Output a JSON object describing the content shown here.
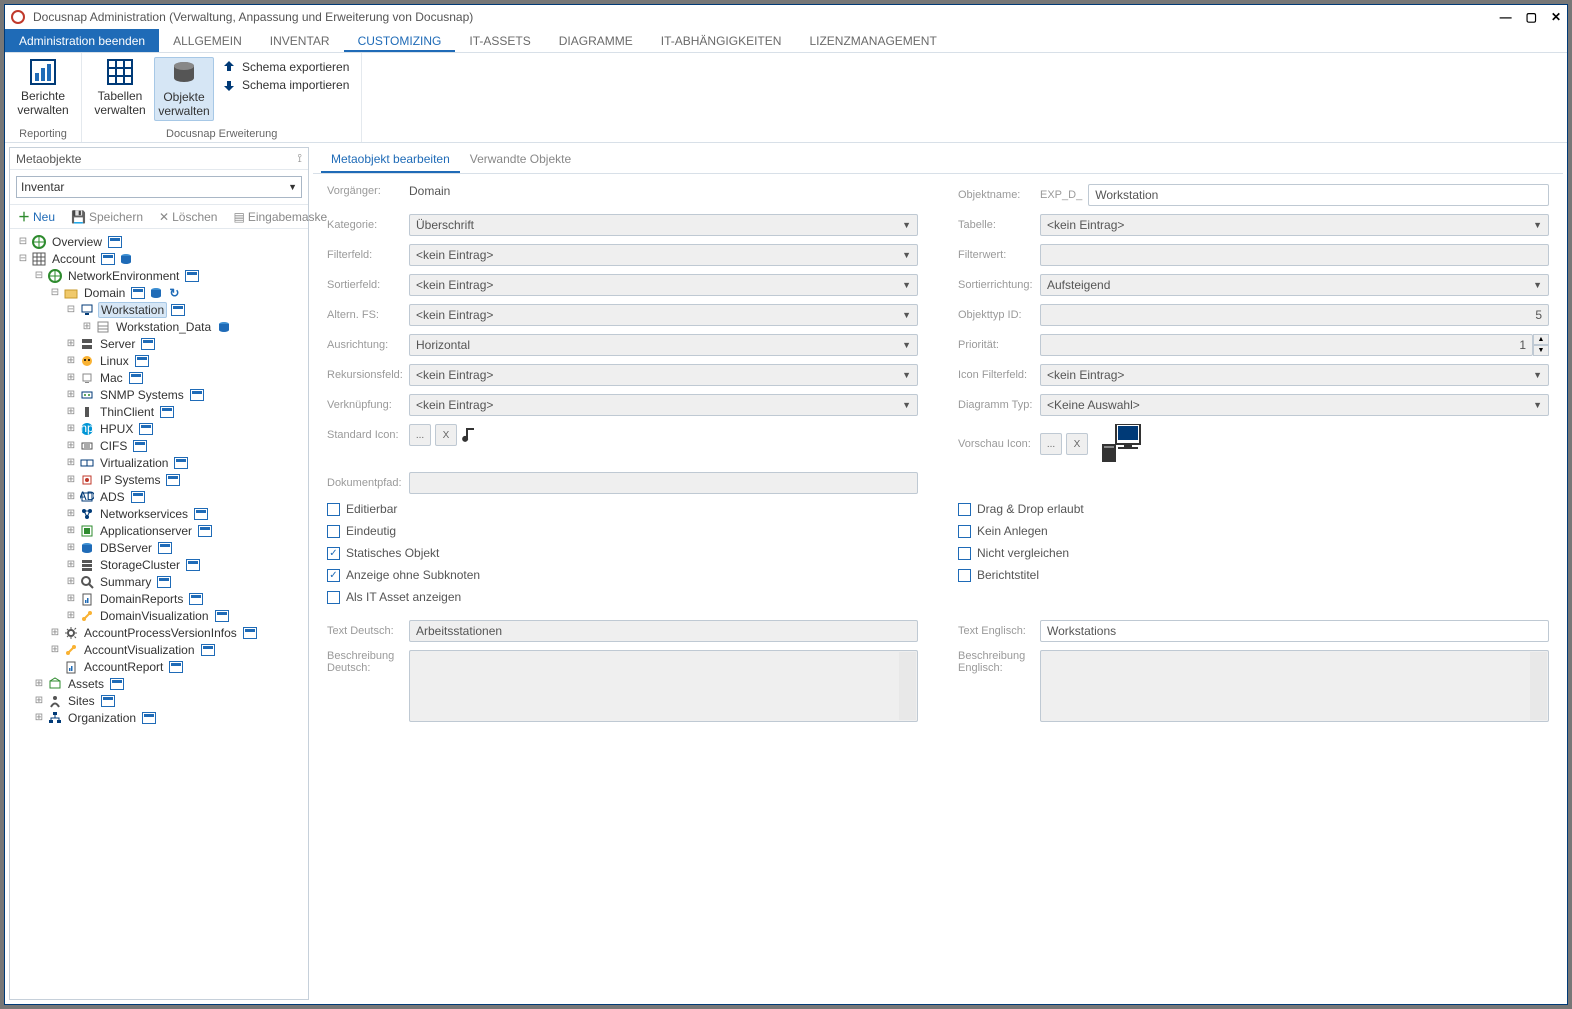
{
  "window": {
    "title": "Docusnap Administration (Verwaltung, Anpassung und Erweiterung von Docusnap)"
  },
  "menu": {
    "primary": "Administration beenden",
    "items": [
      "ALLGEMEIN",
      "INVENTAR",
      "CUSTOMIZING",
      "IT-ASSETS",
      "DIAGRAMME",
      "IT-ABHÄNGIGKEITEN",
      "LIZENZMANAGEMENT"
    ],
    "active_index": 2
  },
  "ribbon": {
    "berichte": "Berichte\nverwalten",
    "tabellen": "Tabellen\nverwalten",
    "objekte": "Objekte\nverwalten",
    "schema_export": "Schema exportieren",
    "schema_import": "Schema importieren",
    "group_reporting": "Reporting",
    "group_ext": "Docusnap Erweiterung"
  },
  "sidebar": {
    "title": "Metaobjekte",
    "selector_value": "Inventar",
    "toolbar": {
      "neu": "Neu",
      "speichern": "Speichern",
      "loeschen": "Löschen",
      "eingabemaske": "Eingabemaske"
    },
    "tree": [
      {
        "d": 0,
        "tw": "-",
        "ico": "globe",
        "txt": "Overview",
        "b": true
      },
      {
        "d": 0,
        "tw": "-",
        "ico": "grid",
        "txt": "Account",
        "b": true,
        "extra": "db"
      },
      {
        "d": 1,
        "tw": "-",
        "ico": "globe",
        "txt": "NetworkEnvironment",
        "b": true
      },
      {
        "d": 2,
        "tw": "-",
        "ico": "folder",
        "txt": "Domain",
        "b": true,
        "extra": "db",
        "refresh": true
      },
      {
        "d": 3,
        "tw": "-",
        "ico": "pc",
        "txt": "Workstation",
        "b": true,
        "sel": true
      },
      {
        "d": 4,
        "tw": "+",
        "ico": "data",
        "txt": "Workstation_Data",
        "b": false,
        "extra": "db"
      },
      {
        "d": 3,
        "tw": "+",
        "ico": "server",
        "txt": "Server",
        "b": true
      },
      {
        "d": 3,
        "tw": "+",
        "ico": "linux",
        "txt": "Linux",
        "b": true
      },
      {
        "d": 3,
        "tw": "+",
        "ico": "mac",
        "txt": "Mac",
        "b": true
      },
      {
        "d": 3,
        "tw": "+",
        "ico": "snmp",
        "txt": "SNMP Systems",
        "b": true
      },
      {
        "d": 3,
        "tw": "+",
        "ico": "thin",
        "txt": "ThinClient",
        "b": true
      },
      {
        "d": 3,
        "tw": "+",
        "ico": "hp",
        "txt": "HPUX",
        "b": true
      },
      {
        "d": 3,
        "tw": "+",
        "ico": "cifs",
        "txt": "CIFS",
        "b": true
      },
      {
        "d": 3,
        "tw": "+",
        "ico": "virt",
        "txt": "Virtualization",
        "b": true
      },
      {
        "d": 3,
        "tw": "+",
        "ico": "ip",
        "txt": "IP Systems",
        "b": true
      },
      {
        "d": 3,
        "tw": "+",
        "ico": "ads",
        "txt": "ADS",
        "b": true
      },
      {
        "d": 3,
        "tw": "+",
        "ico": "net",
        "txt": "Networkservices",
        "b": true
      },
      {
        "d": 3,
        "tw": "+",
        "ico": "app",
        "txt": "Applicationserver",
        "b": true
      },
      {
        "d": 3,
        "tw": "+",
        "ico": "db",
        "txt": "DBServer",
        "b": true
      },
      {
        "d": 3,
        "tw": "+",
        "ico": "storage",
        "txt": "StorageCluster",
        "b": true
      },
      {
        "d": 3,
        "tw": "+",
        "ico": "search",
        "txt": "Summary",
        "b": true
      },
      {
        "d": 3,
        "tw": "+",
        "ico": "report",
        "txt": "DomainReports",
        "b": true
      },
      {
        "d": 3,
        "tw": "+",
        "ico": "vis",
        "txt": "DomainVisualization",
        "b": true
      },
      {
        "d": 2,
        "tw": "+",
        "ico": "gear",
        "txt": "AccountProcessVersionInfos",
        "b": true
      },
      {
        "d": 2,
        "tw": "+",
        "ico": "vis",
        "txt": "AccountVisualization",
        "b": true
      },
      {
        "d": 2,
        "tw": "",
        "ico": "report",
        "txt": "AccountReport",
        "b": true
      },
      {
        "d": 1,
        "tw": "+",
        "ico": "asset",
        "txt": "Assets",
        "b": true
      },
      {
        "d": 1,
        "tw": "+",
        "ico": "site",
        "txt": "Sites",
        "b": true
      },
      {
        "d": 1,
        "tw": "+",
        "ico": "org",
        "txt": "Organization",
        "b": true
      }
    ]
  },
  "tabs": {
    "items": [
      "Metaobjekt bearbeiten",
      "Verwandte Objekte"
    ],
    "active_index": 0
  },
  "form": {
    "labels": {
      "vorgaenger": "Vorgänger:",
      "kategorie": "Kategorie:",
      "filterfeld": "Filterfeld:",
      "sortierfeld": "Sortierfeld:",
      "altern": "Altern. FS:",
      "ausrichtung": "Ausrichtung:",
      "rekursion": "Rekursionsfeld:",
      "verknuepfung": "Verknüpfung:",
      "std_icon": "Standard Icon:",
      "dokpfad": "Dokumentpfad:",
      "objektname": "Objektname:",
      "tabelle": "Tabelle:",
      "filterwert": "Filterwert:",
      "sortierrichtung": "Sortierrichtung:",
      "objekttyp": "Objekttyp ID:",
      "prioritaet": "Priorität:",
      "iconfilter": "Icon Filterfeld:",
      "diagrammtyp": "Diagramm Typ:",
      "vorschau": "Vorschau Icon:",
      "text_de": "Text Deutsch:",
      "text_en": "Text Englisch:",
      "beschr_de": "Beschreibung Deutsch:",
      "beschr_en": "Beschreibung Englisch:"
    },
    "values": {
      "vorgaenger": "Domain",
      "kategorie": "Überschrift",
      "filterfeld": "<kein Eintrag>",
      "sortierfeld": "<kein Eintrag>",
      "altern": "<kein Eintrag>",
      "ausrichtung": "Horizontal",
      "rekursion": "<kein Eintrag>",
      "verknuepfung": "<kein Eintrag>",
      "objektname_prefix": "EXP_D_",
      "objektname": "Workstation",
      "tabelle": "<kein Eintrag>",
      "filterwert": "",
      "sortierrichtung": "Aufsteigend",
      "objekttyp": "5",
      "prioritaet": "1",
      "iconfilter": "<kein Eintrag>",
      "diagrammtyp": "<Keine Auswahl>",
      "text_de": "Arbeitsstationen",
      "text_en": "Workstations",
      "dots": "...",
      "x": "X"
    },
    "checkboxes": {
      "editierbar": {
        "label": "Editierbar",
        "checked": false
      },
      "eindeutig": {
        "label": "Eindeutig",
        "checked": false
      },
      "statisch": {
        "label": "Statisches Objekt",
        "checked": true
      },
      "anzeige": {
        "label": "Anzeige ohne Subknoten",
        "checked": true
      },
      "itasset": {
        "label": "Als IT Asset anzeigen",
        "checked": false
      },
      "dragdrop": {
        "label": "Drag & Drop erlaubt",
        "checked": false
      },
      "keinanlegen": {
        "label": "Kein Anlegen",
        "checked": false
      },
      "nichtvergl": {
        "label": "Nicht vergleichen",
        "checked": false
      },
      "berichtstitel": {
        "label": "Berichtstitel",
        "checked": false
      }
    }
  }
}
